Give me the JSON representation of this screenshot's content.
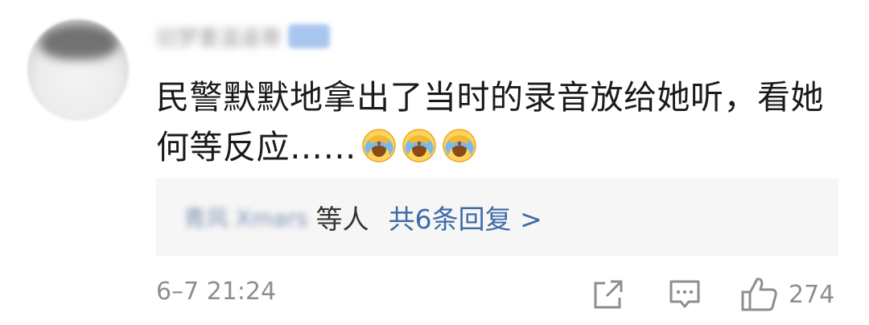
{
  "comment": {
    "username": "旧梦重温遥寄",
    "text": "民警默默地拿出了当时的录音放给她听，看她何等反应……",
    "emojis": [
      "facepalm-cry-emoji",
      "facepalm-cry-emoji",
      "facepalm-cry-emoji"
    ],
    "replies": {
      "users": "青风 Xmars",
      "suffix": "等人",
      "link": "共6条回复 >"
    },
    "timestamp": "6–7 21:24",
    "likes": "274"
  },
  "icons": {
    "share": "share-icon",
    "comment": "comment-icon",
    "like": "thumbs-up-icon"
  },
  "colors": {
    "link": "#3e6aa7",
    "muted": "#8e8e8e",
    "text": "#1a1a1a",
    "reply_bg": "#f6f6f6"
  }
}
